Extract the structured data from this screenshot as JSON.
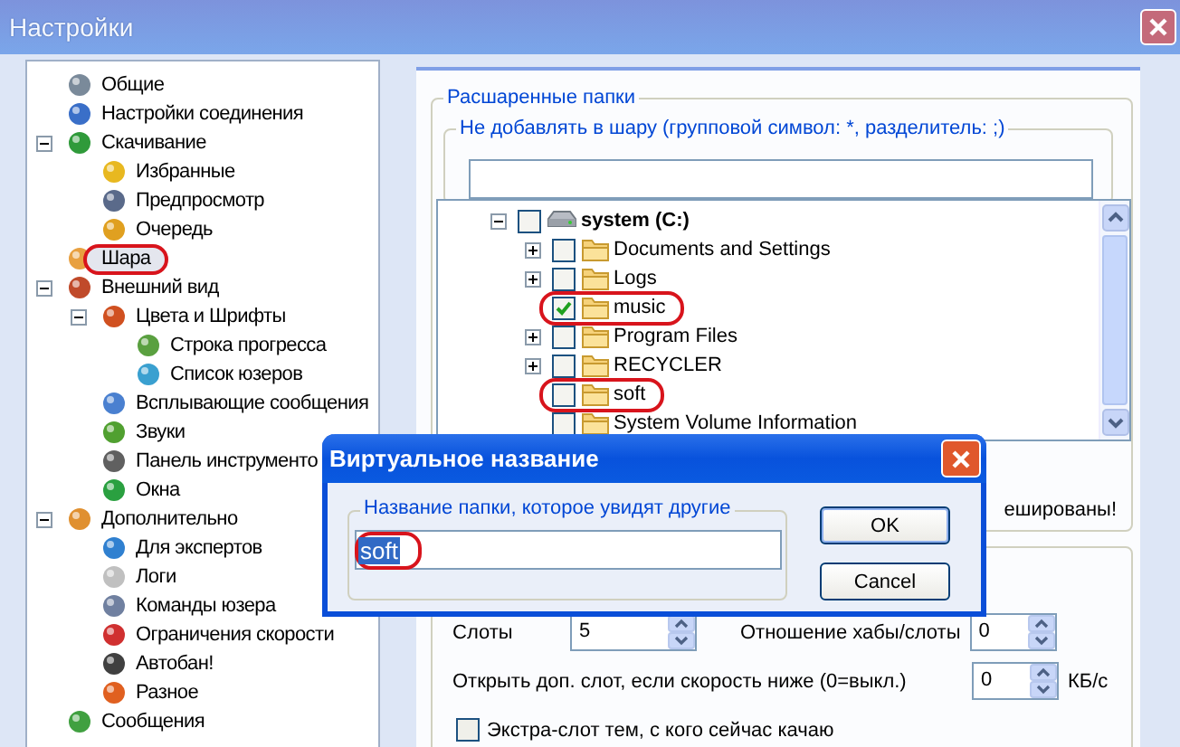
{
  "window": {
    "title": "Настройки"
  },
  "sidebar": {
    "items": [
      {
        "label": "Общие",
        "selected": false,
        "marked": false
      },
      {
        "label": "Настройки соединения",
        "selected": false,
        "marked": false
      },
      {
        "label": "Скачивание",
        "selected": false,
        "marked": false,
        "expanded": true,
        "children": [
          {
            "label": "Избранные",
            "selected": false,
            "marked": false
          },
          {
            "label": "Предпросмотр",
            "selected": false,
            "marked": false
          },
          {
            "label": "Очередь",
            "selected": false,
            "marked": false
          }
        ]
      },
      {
        "label": "Шара",
        "selected": true,
        "marked": true
      },
      {
        "label": "Внешний вид",
        "selected": false,
        "marked": false,
        "expanded": true,
        "children": [
          {
            "label": "Цвета и Шрифты",
            "selected": false,
            "marked": false,
            "expanded": true,
            "children": [
              {
                "label": "Строка прогресса",
                "selected": false,
                "marked": false
              },
              {
                "label": "Список юзеров",
                "selected": false,
                "marked": false
              }
            ]
          },
          {
            "label": "Всплывающие сообщения",
            "selected": false,
            "marked": false
          },
          {
            "label": "Звуки",
            "selected": false,
            "marked": false
          },
          {
            "label": "Панель инструменто",
            "selected": false,
            "marked": false
          },
          {
            "label": "Окна",
            "selected": false,
            "marked": false
          }
        ]
      },
      {
        "label": "Дополнительно",
        "selected": false,
        "marked": false,
        "expanded": true,
        "children": [
          {
            "label": "Для экспертов",
            "selected": false,
            "marked": false
          },
          {
            "label": "Логи",
            "selected": false,
            "marked": false
          },
          {
            "label": "Команды юзера",
            "selected": false,
            "marked": false
          },
          {
            "label": "Ограничения скорости",
            "selected": false,
            "marked": false
          },
          {
            "label": "Автобан!",
            "selected": false,
            "marked": false
          },
          {
            "label": "Разное",
            "selected": false,
            "marked": false
          }
        ]
      },
      {
        "label": "Сообщения",
        "selected": false,
        "marked": false
      }
    ]
  },
  "shared_folders": {
    "title": "Расшаренные папки",
    "exclude": {
      "label": "Не добавлять в шару (групповой символ: *, разделитель: ;)"
    },
    "tree": [
      {
        "label": "system (C:)",
        "kind": "drive",
        "checked": false,
        "expanded": true,
        "marked": false,
        "children": [
          {
            "label": "Documents and Settings",
            "kind": "folder",
            "checked": false,
            "expanded": false,
            "marked": false
          },
          {
            "label": "Logs",
            "kind": "folder",
            "checked": false,
            "expanded": false,
            "marked": false
          },
          {
            "label": "music",
            "kind": "folder",
            "checked": true,
            "marked": true
          },
          {
            "label": "Program Files",
            "kind": "folder",
            "checked": false,
            "expanded": false,
            "marked": false
          },
          {
            "label": "RECYCLER",
            "kind": "folder",
            "checked": false,
            "expanded": false,
            "marked": false
          },
          {
            "label": "soft",
            "kind": "folder",
            "checked": false,
            "marked": true
          },
          {
            "label": "System Volume Information",
            "kind": "folder",
            "checked": false,
            "marked": false
          }
        ]
      }
    ],
    "note": "ешированы!"
  },
  "slots": {
    "slots_label": "Слоты",
    "slots_value": "5",
    "ratio_label": "Отношение хабы/слоты",
    "ratio_value": "0",
    "extra_label": "Открыть доп. слот, если скорость ниже (0=выкл.)",
    "extra_value": "0",
    "extra_unit": "КБ/с",
    "extra_slot": {
      "label": "Экстра-слот тем, с кого сейчас качаю",
      "checked": false
    }
  },
  "dialog": {
    "title": "Виртуальное название",
    "field": {
      "label": "Название папки, которое увидят другие",
      "value": "soft",
      "value_selected": true,
      "marked": true
    },
    "buttons": [
      {
        "label": "OK",
        "default": true
      },
      {
        "label": "Cancel",
        "default": false
      }
    ]
  }
}
